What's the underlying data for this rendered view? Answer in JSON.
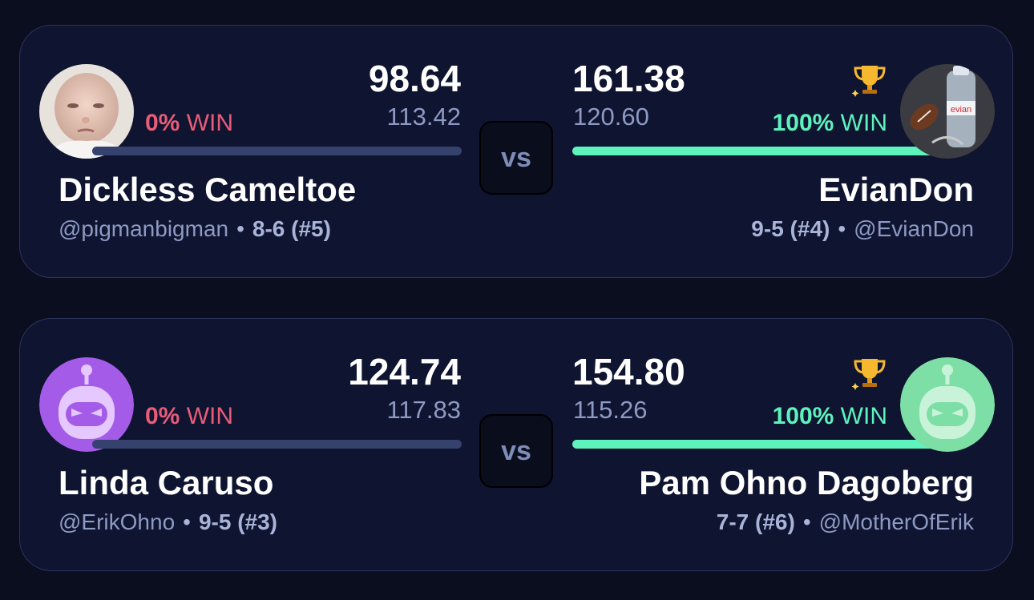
{
  "vs_label": "vs",
  "win_suffix": "WIN",
  "colors": {
    "background": "#0b0e1e",
    "card": "#0f1430",
    "win": "#5ef2bd",
    "lose": "#e85c78",
    "muted": "#8d9ac3"
  },
  "matchups": [
    {
      "left": {
        "name": "Dickless Cameltoe",
        "handle": "@pigmanbigman",
        "record": "8-6 (#5)",
        "score": "98.64",
        "projected": "113.42",
        "win_pct": "0%",
        "win_fraction": 0.0,
        "avatar": "baby-photo-avatar"
      },
      "right": {
        "name": "EvianDon",
        "handle": "@EvianDon",
        "record": "9-5 (#4)",
        "score": "161.38",
        "projected": "120.60",
        "win_pct": "100%",
        "win_fraction": 1.0,
        "avatar": "evian-bottle-football-avatar",
        "trophy_icon": "trophy-icon"
      }
    },
    {
      "left": {
        "name": "Linda Caruso",
        "handle": "@ErikOhno",
        "record": "9-5 (#3)",
        "score": "124.74",
        "projected": "117.83",
        "win_pct": "0%",
        "win_fraction": 0.0,
        "avatar": "purple-robot-avatar"
      },
      "right": {
        "name": "Pam Ohno Dagoberg",
        "handle": "@MotherOfErik",
        "record": "7-7 (#6)",
        "score": "154.80",
        "projected": "115.26",
        "win_pct": "100%",
        "win_fraction": 1.0,
        "avatar": "green-robot-avatar",
        "trophy_icon": "trophy-icon"
      }
    }
  ]
}
